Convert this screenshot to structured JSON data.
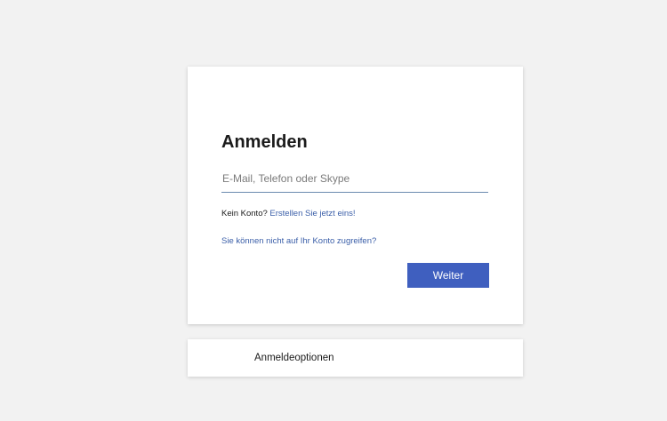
{
  "signin": {
    "title": "Anmelden",
    "email_placeholder": "E-Mail, Telefon oder Skype",
    "email_value": "",
    "no_account_text": "Kein Konto?",
    "create_link": "Erstellen Sie jetzt eins!",
    "cant_access_link": "Sie können nicht auf Ihr Konto zugreifen?",
    "next_button": "Weiter"
  },
  "options": {
    "label": "Anmeldeoptionen"
  },
  "colors": {
    "background": "#f2f2f2",
    "link": "#3a5ea8",
    "primary_button": "#3f5fbf"
  }
}
